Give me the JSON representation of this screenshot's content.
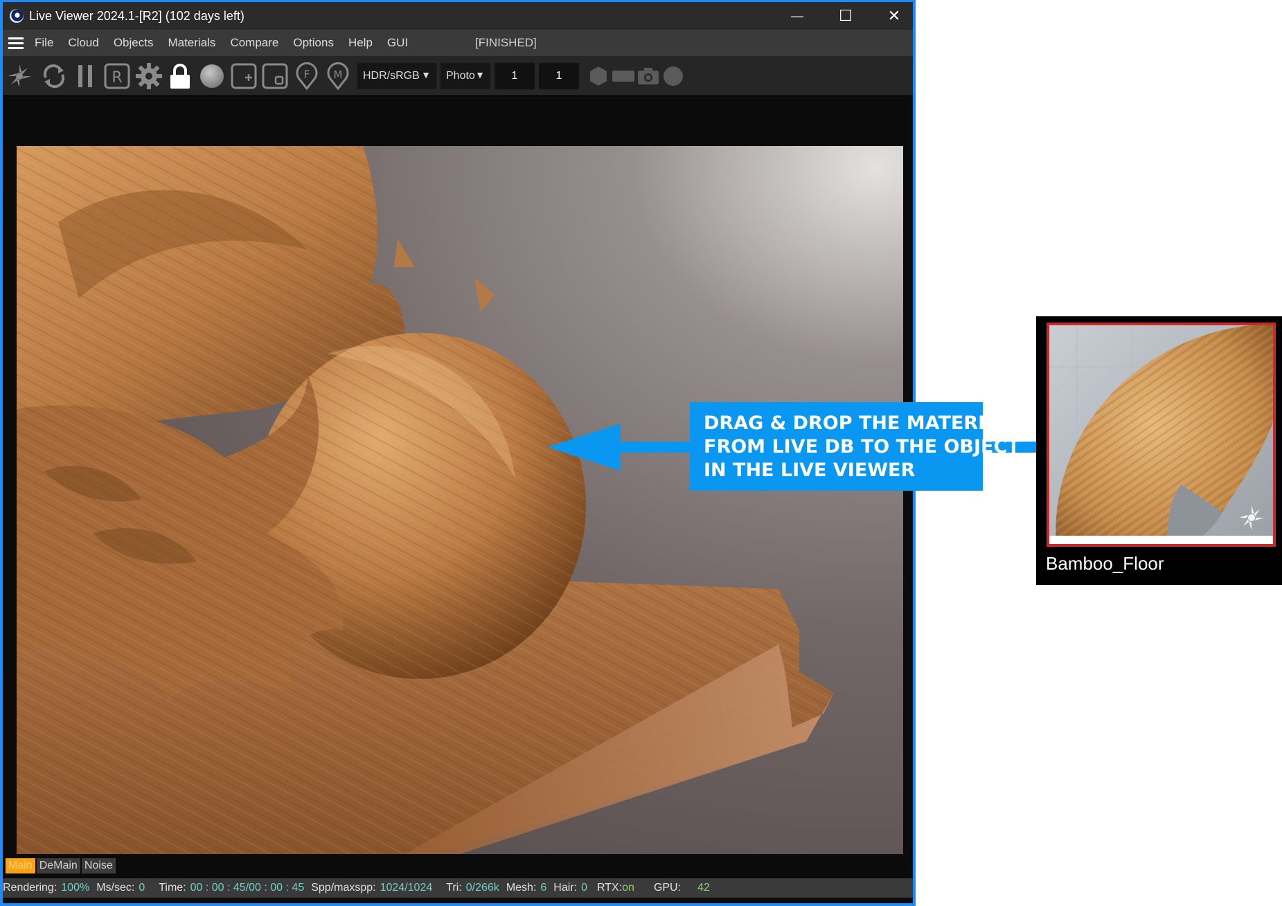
{
  "window": {
    "title": "Live Viewer 2024.1-[R2] (102 days left)",
    "controls": {
      "minimize": "—",
      "maximize": "☐",
      "close": "✕"
    }
  },
  "menu": {
    "items": [
      "File",
      "Cloud",
      "Objects",
      "Materials",
      "Compare",
      "Options",
      "Help",
      "GUI"
    ],
    "status": "[FINISHED]"
  },
  "toolbar": {
    "icons": [
      "octane-icon",
      "refresh-icon",
      "pause-icon",
      "r-icon",
      "gear-icon",
      "lock-icon",
      "sphere-icon",
      "add-icon",
      "region-icon",
      "f-pin-icon",
      "m-pin-icon"
    ],
    "colorspace": "HDR/sRGB",
    "mode": "Photo",
    "value_a": "1",
    "value_b": "1",
    "extra_icons": [
      "hexagon-icon",
      "rectangle-icon",
      "camera-icon",
      "circle-icon"
    ]
  },
  "tabs": [
    "Main",
    "DeMain",
    "Noise"
  ],
  "statusbar": {
    "rendering_label": "Rendering:",
    "rendering_value": "100%",
    "mssec_label": "Ms/sec:",
    "mssec_value": "0",
    "time_label": "Time:",
    "time_value": "00 : 00 : 45/00 : 00 : 45",
    "spp_label": "Spp/maxspp:",
    "spp_value": "1024/1024",
    "tri_label": "Tri:",
    "tri_value": "0/266k",
    "mesh_label": "Mesh:",
    "mesh_value": "6",
    "hair_label": "Hair:",
    "hair_value": "0",
    "rtx_label": "RTX:",
    "rtx_value": "on",
    "gpu_label": "GPU:",
    "gpu_value": "42"
  },
  "callout": {
    "line1": "DRAG & DROP THE MATERIAL",
    "line2": "FROM LIVE DB TO THE OBJECT",
    "line3": "IN THE LIVE VIEWER"
  },
  "material": {
    "name": "Bamboo_Floor"
  },
  "colors": {
    "accent_blue": "#0a97f2",
    "window_border": "#1a8cff",
    "active_tab": "#f6a31a",
    "thumb_border": "#c62b2b"
  }
}
